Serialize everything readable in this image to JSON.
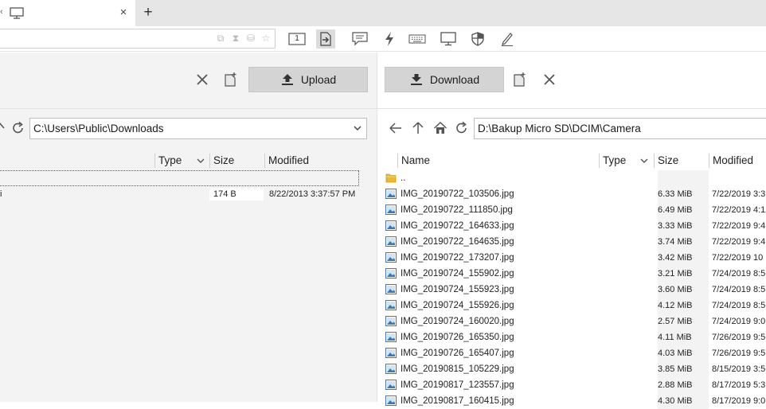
{
  "tabs": {
    "new_tab_label": "+",
    "close_label": "×"
  },
  "toolbar": {
    "page_number_label": "1"
  },
  "left": {
    "upload_label": "Upload",
    "path": "C:\\Users\\Public\\Downloads",
    "columns": {
      "type": "Type",
      "size": "Size",
      "modified": "Modified"
    },
    "rows": [
      {
        "name_fragment": "i",
        "size": "174 B",
        "modified": "8/22/2013 3:37:57 PM"
      }
    ]
  },
  "right": {
    "download_label": "Download",
    "path": "D:\\Bakup Micro SD\\DCIM\\Camera",
    "columns": {
      "name": "Name",
      "type": "Type",
      "size": "Size",
      "modified": "Modified"
    },
    "parent_label": "..",
    "files": [
      {
        "name": "IMG_20190722_103506.jpg",
        "size": "6.33 MiB",
        "modified": "7/22/2019 3:3"
      },
      {
        "name": "IMG_20190722_111850.jpg",
        "size": "6.49 MiB",
        "modified": "7/22/2019 4:1"
      },
      {
        "name": "IMG_20190722_164633.jpg",
        "size": "3.33 MiB",
        "modified": "7/22/2019 9:4"
      },
      {
        "name": "IMG_20190722_164635.jpg",
        "size": "3.74 MiB",
        "modified": "7/22/2019 9:4"
      },
      {
        "name": "IMG_20190722_173207.jpg",
        "size": "3.42 MiB",
        "modified": "7/22/2019 10"
      },
      {
        "name": "IMG_20190724_155902.jpg",
        "size": "3.21 MiB",
        "modified": "7/24/2019 8:5"
      },
      {
        "name": "IMG_20190724_155923.jpg",
        "size": "3.60 MiB",
        "modified": "7/24/2019 8:5"
      },
      {
        "name": "IMG_20190724_155926.jpg",
        "size": "4.12 MiB",
        "modified": "7/24/2019 8:5"
      },
      {
        "name": "IMG_20190724_160020.jpg",
        "size": "2.57 MiB",
        "modified": "7/24/2019 9:0"
      },
      {
        "name": "IMG_20190726_165350.jpg",
        "size": "4.11 MiB",
        "modified": "7/26/2019 9:5"
      },
      {
        "name": "IMG_20190726_165407.jpg",
        "size": "4.03 MiB",
        "modified": "7/26/2019 9:5"
      },
      {
        "name": "IMG_20190815_105229.jpg",
        "size": "3.85 MiB",
        "modified": "8/15/2019 3:5"
      },
      {
        "name": "IMG_20190817_123557.jpg",
        "size": "2.88 MiB",
        "modified": "8/17/2019 5:3"
      },
      {
        "name": "IMG_20190817_160415.jpg",
        "size": "4.30 MiB",
        "modified": "8/17/2019 9:0"
      }
    ]
  }
}
